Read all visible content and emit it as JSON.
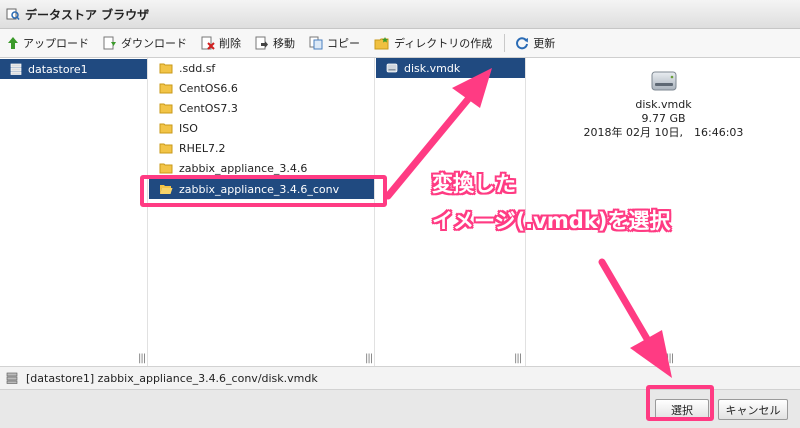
{
  "window": {
    "title": "データストア ブラウザ"
  },
  "toolbar": {
    "upload": "アップロード",
    "download": "ダウンロード",
    "delete": "削除",
    "move": "移動",
    "copy": "コピー",
    "new_folder": "ディレクトリの作成",
    "refresh": "更新"
  },
  "datastores": [
    "datastore1"
  ],
  "folders": [
    ".sdd.sf",
    "CentOS6.6",
    "CentOS7.3",
    "ISO",
    "RHEL7.2",
    "zabbix_appliance_3.4.6",
    "zabbix_appliance_3.4.6_conv"
  ],
  "files": [
    "disk.vmdk"
  ],
  "preview": {
    "name": "disk.vmdk",
    "size": "9.77 GB",
    "date": "2018年 02月 10日,　16:46:03"
  },
  "status": {
    "path": "[datastore1] zabbix_appliance_3.4.6_conv/disk.vmdk"
  },
  "buttons": {
    "select": "選択",
    "cancel": "キャンセル"
  },
  "annotation": {
    "line1": "変換した",
    "line2": "イメージ(.vmdk)を選択"
  },
  "grip": "|||",
  "colors": {
    "selection": "#204a80",
    "highlight": "#ff3b83"
  }
}
